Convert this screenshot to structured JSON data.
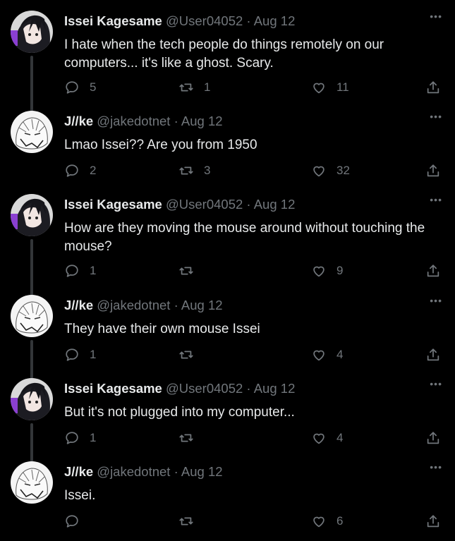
{
  "thread": [
    {
      "author": "Issei Kagesame",
      "handle": "@User04052",
      "sep": "·",
      "date": "Aug 12",
      "text": "I hate when the tech people do things remotely on our computers... it's like a ghost. Scary.",
      "replies": "5",
      "retweets": "1",
      "likes": "11",
      "avatar": "dark-hair-avatar"
    },
    {
      "author": "J//ke",
      "handle": "@jakedotnet",
      "sep": "·",
      "date": "Aug 12",
      "text": "Lmao Issei?? Are you from 1950",
      "replies": "2",
      "retweets": "3",
      "likes": "32",
      "avatar": "white-hair-avatar"
    },
    {
      "author": "Issei Kagesame",
      "handle": "@User04052",
      "sep": "·",
      "date": "Aug 12",
      "text": "How are they moving the mouse around without touching the mouse?",
      "replies": "1",
      "retweets": "",
      "likes": "9",
      "avatar": "dark-hair-avatar"
    },
    {
      "author": "J//ke",
      "handle": "@jakedotnet",
      "sep": "·",
      "date": "Aug 12",
      "text": "They have their own mouse Issei",
      "replies": "1",
      "retweets": "",
      "likes": "4",
      "avatar": "white-hair-avatar"
    },
    {
      "author": "Issei Kagesame",
      "handle": "@User04052",
      "sep": "·",
      "date": "Aug 12",
      "text": "But it's not plugged into my computer...",
      "replies": "1",
      "retweets": "",
      "likes": "4",
      "avatar": "dark-hair-avatar"
    },
    {
      "author": "J//ke",
      "handle": "@jakedotnet",
      "sep": "·",
      "date": "Aug 12",
      "text": "Issei.",
      "replies": "",
      "retweets": "",
      "likes": "6",
      "avatar": "white-hair-avatar"
    }
  ],
  "more_label": "•••",
  "colors": {
    "background": "#000000",
    "text": "#e7e9ea",
    "muted": "#71767b",
    "thread_line": "#333639"
  }
}
